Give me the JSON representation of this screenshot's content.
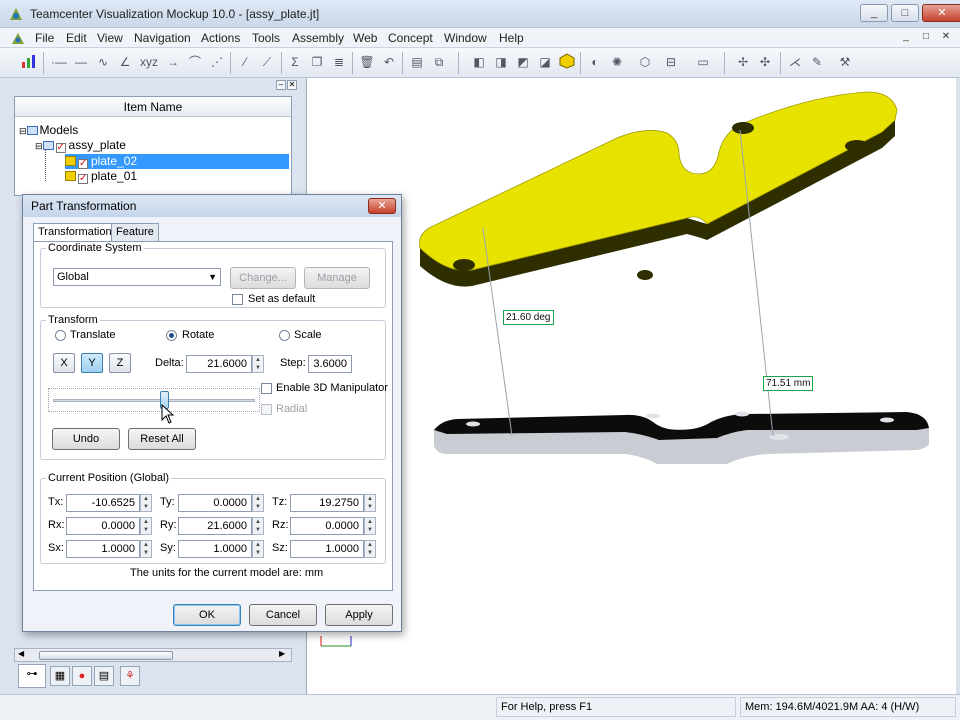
{
  "window": {
    "title": "Teamcenter Visualization Mockup 10.0 - [assy_plate.jt]",
    "controls": [
      "_",
      "□",
      "✕"
    ]
  },
  "menu": {
    "items": [
      "File",
      "Edit",
      "View",
      "Navigation",
      "Actions",
      "Tools",
      "Assembly",
      "Web",
      "Concept",
      "Window",
      "Help"
    ],
    "mdi_controls": [
      "_",
      "□",
      "✕"
    ]
  },
  "tree": {
    "column_header": "Item Name",
    "nodes": [
      {
        "label": "Models",
        "level": 0
      },
      {
        "label": "assy_plate",
        "level": 1
      },
      {
        "label": "plate_02",
        "level": 2,
        "selected": true
      },
      {
        "label": "plate_01",
        "level": 2,
        "selected": false
      }
    ]
  },
  "dialog": {
    "title": "Part Transformation",
    "tabs": [
      "Transformation",
      "Feature"
    ],
    "coordinate_system": {
      "label": "Coordinate System",
      "value": "Global",
      "change_label": "Change...",
      "manage_label": "Manage",
      "set_default_label": "Set as default"
    },
    "transform": {
      "label": "Transform",
      "modes": [
        "Translate",
        "Rotate",
        "Scale"
      ],
      "selected_mode": "Rotate",
      "axes": [
        "X",
        "Y",
        "Z"
      ],
      "selected_axis": "Y",
      "delta_label": "Delta:",
      "delta_value": "21.6000",
      "step_label": "Step:",
      "step_value": "3.6000",
      "enable_3d_label": "Enable 3D Manipulator",
      "radial_label": "Radial",
      "slider_position": 0.55,
      "undo_label": "Undo",
      "reset_label": "Reset All"
    },
    "position": {
      "label": "Current Position (Global)",
      "rows": [
        [
          {
            "k": "Tx:",
            "v": "-10.6525"
          },
          {
            "k": "Ty:",
            "v": "0.0000"
          },
          {
            "k": "Tz:",
            "v": "19.2750"
          }
        ],
        [
          {
            "k": "Rx:",
            "v": "0.0000"
          },
          {
            "k": "Ry:",
            "v": "21.6000"
          },
          {
            "k": "Rz:",
            "v": "0.0000"
          }
        ],
        [
          {
            "k": "Sx:",
            "v": "1.0000"
          },
          {
            "k": "Sy:",
            "v": "1.0000"
          },
          {
            "k": "Sz:",
            "v": "1.0000"
          }
        ]
      ]
    },
    "units_note": "The units for the current model are: mm",
    "ok_label": "OK",
    "cancel_label": "Cancel",
    "apply_label": "Apply"
  },
  "viewport": {
    "angle_label": "21.60 deg",
    "distance_label": "71.51 mm",
    "colors": {
      "top_plate": "#e8e200",
      "top_plate_dark": "#2e2e00",
      "bottom_plate": "#c9ccd2",
      "measure": "#16a34a"
    }
  },
  "status": {
    "help": "For Help, press F1",
    "memory": "Mem: 194.6M/4021.9M  AA: 4 (H/W)"
  }
}
